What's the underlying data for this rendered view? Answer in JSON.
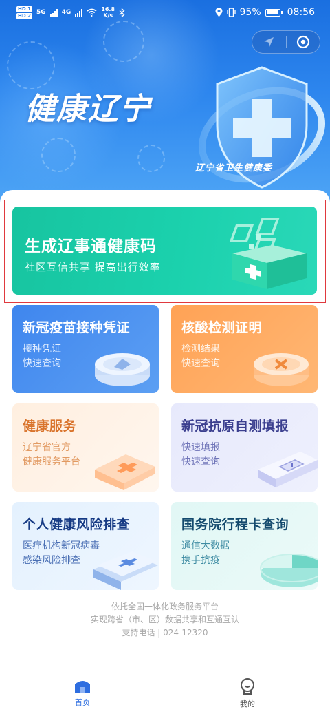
{
  "status_bar": {
    "hd1": "HD 1",
    "hd2": "HD 2",
    "net1": "5G",
    "net2": "4G",
    "speed_value": "16.8",
    "speed_unit": "K/s",
    "battery": "95%",
    "time": "08:56"
  },
  "hero": {
    "title": "健康辽宁",
    "org": "辽宁省卫生健康委"
  },
  "main_card": {
    "title": "生成辽事通健康码",
    "subtitle": "社区互信共享 提高出行效率"
  },
  "cards": {
    "vaccine": {
      "title": "新冠疫苗接种凭证",
      "line1": "接种凭证",
      "line2": "快速查询"
    },
    "nucleic": {
      "title": "核酸检测证明",
      "line1": "检测结果",
      "line2": "快速查询"
    },
    "health": {
      "title": "健康服务",
      "line1": "辽宁省官方",
      "line2": "健康服务平台"
    },
    "antigen": {
      "title": "新冠抗原自测填报",
      "line1": "快速填报",
      "line2": "快速查询"
    },
    "risk": {
      "title": "个人健康风险排查",
      "line1": "医疗机构新冠病毒",
      "line2": "感染风险排查"
    },
    "trip": {
      "title": "国务院行程卡查询",
      "line1": "通信大数据",
      "line2": "携手抗疫"
    }
  },
  "footer": {
    "line1": "依托全国一体化政务服务平台",
    "line2": "实现跨省（市、区）数据共享和互通互认",
    "line3": "支持电话 | 024-12320"
  },
  "tabbar": {
    "home": "首页",
    "me": "我的"
  },
  "colors": {
    "hero_blue": "#2d86ee",
    "main_green": "#1bd1ad",
    "vaccine_blue": "#4a90f0",
    "nucleic_orange": "#ffa860",
    "tab_active": "#2e6ee0",
    "highlight_red": "#e0393e"
  },
  "icons": {
    "location": "location-pin-icon",
    "vibrate": "vibrate-icon",
    "wifi": "wifi-icon",
    "bluetooth": "bluetooth-icon",
    "nav": "navigation-arrow-icon",
    "target": "target-circle-icon",
    "home": "home-icon",
    "me": "user-icon"
  }
}
